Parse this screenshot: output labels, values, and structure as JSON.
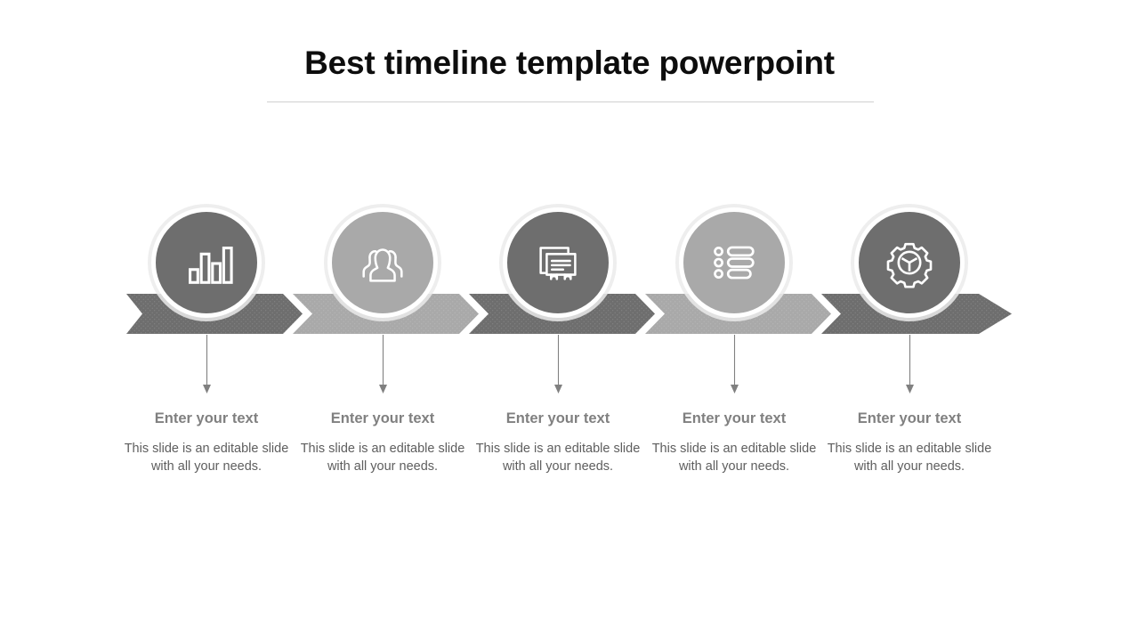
{
  "slide": {
    "title": "Best timeline template powerpoint",
    "background_color": "#ffffff",
    "title_color": "#0d0d0d",
    "divider_color": "#d0d0d0"
  },
  "palette": {
    "dark_gray": "#6e6e6e",
    "light_gray": "#a9a9a9",
    "arrow_dark": "#6e6e6e",
    "arrow_light": "#a9a9a9",
    "ring_white": "#ffffff",
    "heading_text": "#808080",
    "body_text": "#5e5e5e",
    "connector_line": "#808080"
  },
  "timeline": {
    "step_count": 5,
    "steps": [
      {
        "index": "1",
        "icon": "bar-chart-icon",
        "tone": "dark",
        "heading": "Enter your text",
        "body": "This slide is an editable slide with all your needs."
      },
      {
        "index": "2",
        "icon": "group-people-icon",
        "tone": "light",
        "heading": "Enter your text",
        "body": "This slide is an editable slide with all your needs."
      },
      {
        "index": "3",
        "icon": "certificate-documents-icon",
        "tone": "dark",
        "heading": "Enter your text",
        "body": "This slide is an editable slide with all your needs."
      },
      {
        "index": "4",
        "icon": "bullet-list-icon",
        "tone": "light",
        "heading": "Enter your text",
        "body": "This slide is an editable slide with all your needs."
      },
      {
        "index": "5",
        "icon": "gear-wheel-icon",
        "tone": "dark",
        "heading": "Enter your text",
        "body": "This slide is an editable slide with all your needs."
      }
    ]
  }
}
